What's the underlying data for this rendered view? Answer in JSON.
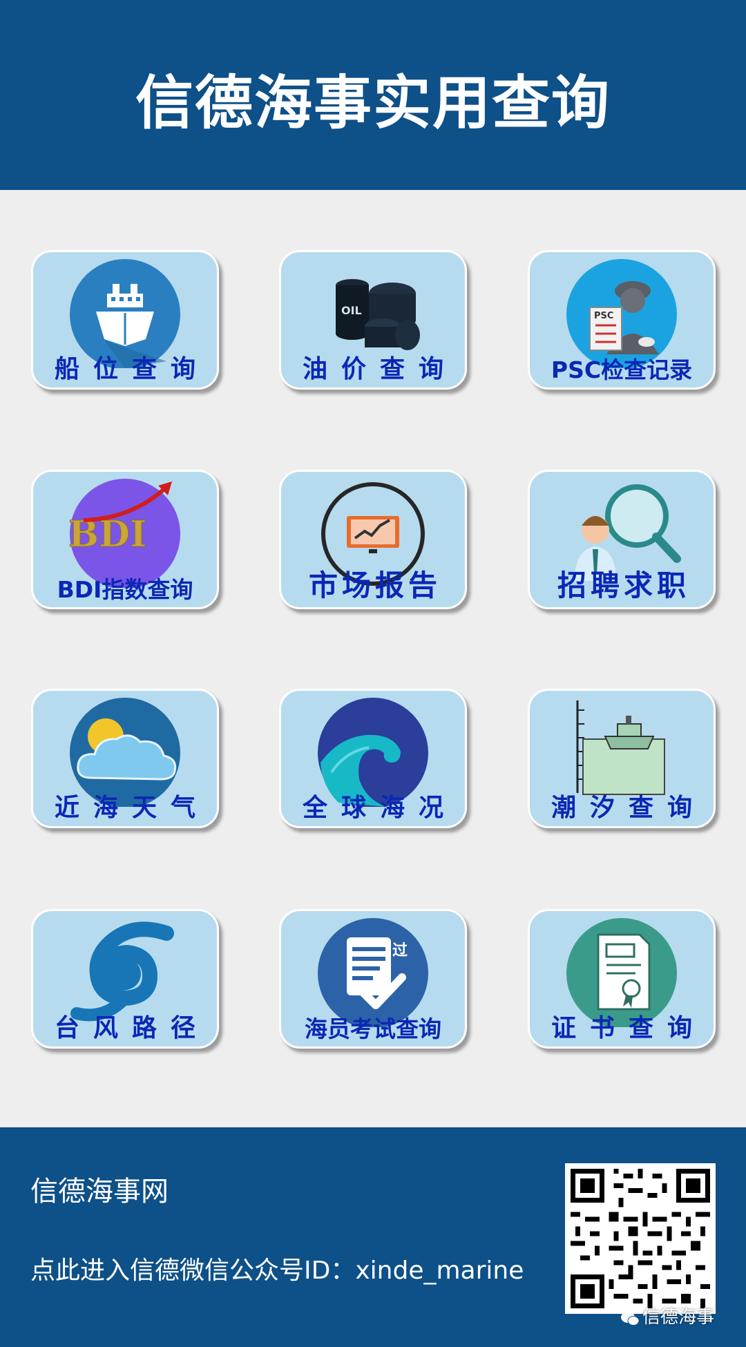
{
  "header": {
    "title": "信德海事实用查询"
  },
  "tiles": [
    {
      "label": "船位查询",
      "icon": "ship-icon"
    },
    {
      "label": "油价查询",
      "icon": "oil-barrels-icon"
    },
    {
      "label": "PSC检查记录",
      "icon": "psc-inspector-icon",
      "icon_text": "PSC"
    },
    {
      "label": "BDI指数查询",
      "icon": "bdi-index-icon",
      "icon_text": "BDI"
    },
    {
      "label": "市场报告",
      "icon": "market-report-icon"
    },
    {
      "label": "招聘求职",
      "icon": "recruitment-icon"
    },
    {
      "label": "近海天气",
      "icon": "weather-icon"
    },
    {
      "label": "全球海况",
      "icon": "ocean-wave-icon"
    },
    {
      "label": "潮汐查询",
      "icon": "tide-icon"
    },
    {
      "label": "台风路径",
      "icon": "typhoon-icon"
    },
    {
      "label": "海员考试查询",
      "icon": "exam-icon",
      "icon_text": "过"
    },
    {
      "label": "证书查询",
      "icon": "certificate-icon"
    }
  ],
  "footer": {
    "site_name": "信德海事网",
    "link_text": "点此进入信德微信公众号ID：xinde_marine",
    "watermark": "信德海事"
  },
  "colors": {
    "header_bg": "#0e5088",
    "tile_bg": "#b6dbef",
    "label": "#0b27b5",
    "page_bg": "#eeeeee"
  }
}
